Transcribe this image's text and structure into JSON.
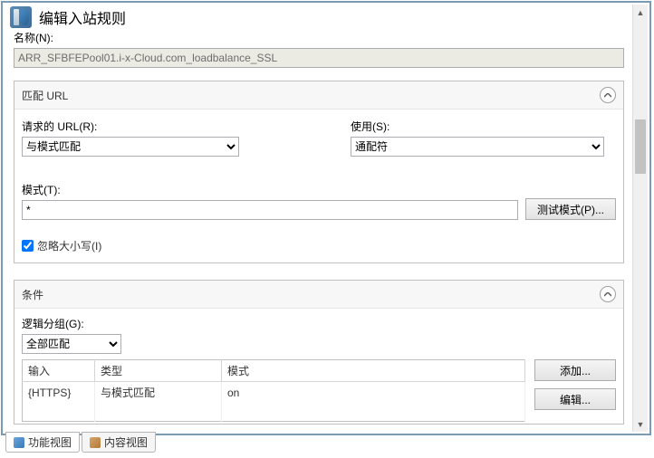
{
  "header": {
    "title": "编辑入站规则"
  },
  "name": {
    "label": "名称(N):",
    "value": "ARR_SFBFEPool01.i-x-Cloud.com_loadbalance_SSL"
  },
  "matchUrl": {
    "title": "匹配 URL",
    "requestedUrl": {
      "label": "请求的 URL(R):",
      "value": "与模式匹配"
    },
    "using": {
      "label": "使用(S):",
      "value": "通配符"
    },
    "pattern": {
      "label": "模式(T):",
      "value": "*"
    },
    "testButton": "测试模式(P)...",
    "ignoreCase": {
      "label": "忽略大小写(I)",
      "checked": true
    }
  },
  "conditions": {
    "title": "条件",
    "logicGroup": {
      "label": "逻辑分组(G):",
      "value": "全部匹配"
    },
    "columns": {
      "input": "输入",
      "type": "类型",
      "pattern": "模式"
    },
    "rows": [
      {
        "input": "{HTTPS}",
        "type": "与模式匹配",
        "pattern": "on"
      }
    ],
    "buttons": {
      "add": "添加...",
      "edit": "编辑..."
    }
  },
  "tabs": {
    "functionView": "功能视图",
    "contentView": "内容视图"
  }
}
